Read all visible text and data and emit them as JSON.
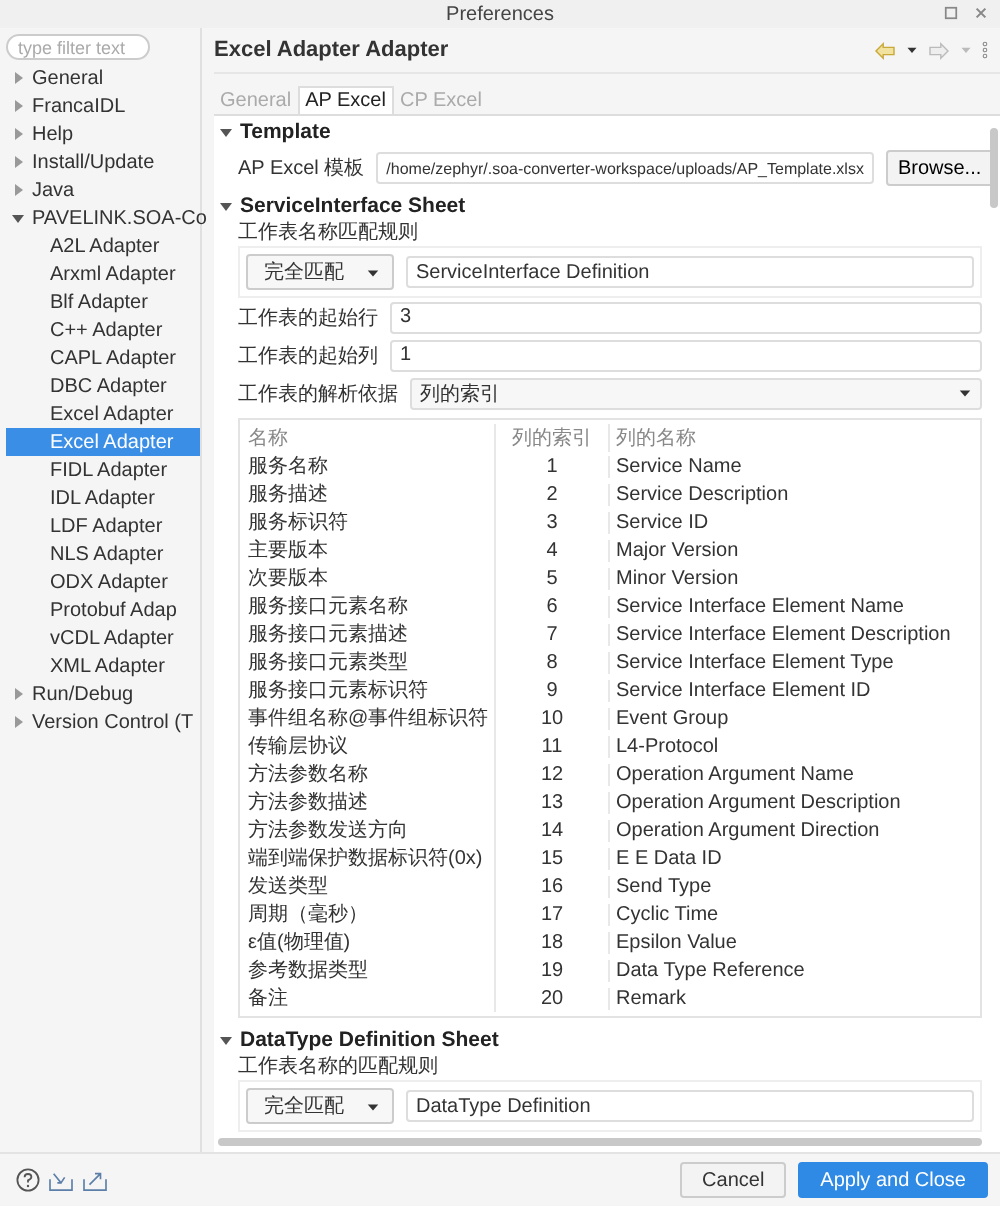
{
  "window": {
    "title": "Preferences"
  },
  "sidebar": {
    "filter_placeholder": "type filter text",
    "items": [
      {
        "label": "General",
        "expanded": false,
        "selected": false
      },
      {
        "label": "FrancaIDL",
        "expanded": false,
        "selected": false
      },
      {
        "label": "Help",
        "expanded": false,
        "selected": false
      },
      {
        "label": "Install/Update",
        "expanded": false,
        "selected": false
      },
      {
        "label": "Java",
        "expanded": false,
        "selected": false
      },
      {
        "label": "PAVELINK.SOA-Co",
        "expanded": true,
        "selected": false,
        "children": [
          {
            "label": "A2L Adapter",
            "selected": false
          },
          {
            "label": "Arxml Adapter",
            "selected": false
          },
          {
            "label": "Blf Adapter",
            "selected": false
          },
          {
            "label": "C++ Adapter",
            "selected": false
          },
          {
            "label": "CAPL Adapter",
            "selected": false
          },
          {
            "label": "DBC Adapter",
            "selected": false
          },
          {
            "label": "Excel Adapter",
            "selected": false
          },
          {
            "label": "Excel Adapter",
            "selected": true
          },
          {
            "label": "FIDL Adapter",
            "selected": false
          },
          {
            "label": "IDL Adapter",
            "selected": false
          },
          {
            "label": "LDF Adapter",
            "selected": false
          },
          {
            "label": "NLS Adapter",
            "selected": false
          },
          {
            "label": "ODX Adapter",
            "selected": false
          },
          {
            "label": "Protobuf Adap",
            "selected": false
          },
          {
            "label": "vCDL Adapter",
            "selected": false
          },
          {
            "label": "XML Adapter",
            "selected": false
          }
        ]
      },
      {
        "label": "Run/Debug",
        "expanded": false,
        "selected": false
      },
      {
        "label": "Version Control (T",
        "expanded": false,
        "selected": false
      }
    ]
  },
  "page": {
    "title": "Excel Adapter Adapter",
    "tabs": [
      {
        "label": "General",
        "selected": false
      },
      {
        "label": "AP Excel",
        "selected": true
      },
      {
        "label": "CP Excel",
        "selected": false
      }
    ]
  },
  "template": {
    "heading": "Template",
    "expanded": true,
    "label": "AP Excel 模板",
    "path": "/home/zephyr/.soa-converter-workspace/uploads/AP_Template.xlsx",
    "button": "Browse..."
  },
  "service_sheet": {
    "heading": "ServiceInterface Sheet",
    "expanded": true,
    "match_label": "工作表名称匹配规则",
    "match_mode": "完全匹配",
    "match_value": "ServiceInterface Definition",
    "settings": [
      {
        "label": "工作表的起始行",
        "kind": "text",
        "value": "3"
      },
      {
        "label": "工作表的起始列",
        "kind": "text",
        "value": "1"
      },
      {
        "label": "工作表的解析依据",
        "kind": "select",
        "value": "列的索引"
      }
    ],
    "table": {
      "columns": [
        "名称",
        "列的索引",
        "列的名称"
      ],
      "rows": [
        [
          "服务名称",
          "1",
          "Service Name"
        ],
        [
          "服务描述",
          "2",
          "Service Description"
        ],
        [
          "服务标识符",
          "3",
          "Service ID"
        ],
        [
          "主要版本",
          "4",
          "Major Version"
        ],
        [
          "次要版本",
          "5",
          "Minor Version"
        ],
        [
          "服务接口元素名称",
          "6",
          "Service Interface Element Name"
        ],
        [
          "服务接口元素描述",
          "7",
          "Service Interface Element Description"
        ],
        [
          "服务接口元素类型",
          "8",
          "Service Interface Element Type"
        ],
        [
          "服务接口元素标识符",
          "9",
          "Service Interface Element ID"
        ],
        [
          "事件组名称@事件组标识符",
          "10",
          "Event Group"
        ],
        [
          "传输层协议",
          "11",
          "L4-Protocol"
        ],
        [
          "方法参数名称",
          "12",
          "Operation Argument Name"
        ],
        [
          "方法参数描述",
          "13",
          "Operation Argument Description"
        ],
        [
          "方法参数发送方向",
          "14",
          "Operation Argument Direction"
        ],
        [
          "端到端保护数据标识符(0x)",
          "15",
          "E E Data ID"
        ],
        [
          "发送类型",
          "16",
          "Send Type"
        ],
        [
          "周期（毫秒）",
          "17",
          "Cyclic Time"
        ],
        [
          "ε值(物理值)",
          "18",
          "Epsilon Value"
        ],
        [
          "参考数据类型",
          "19",
          "Data Type Reference"
        ],
        [
          "备注",
          "20",
          "Remark"
        ]
      ]
    }
  },
  "datatype_sheet": {
    "heading": "DataType Definition Sheet",
    "expanded": true,
    "match_label": "工作表名称的匹配规则",
    "match_mode": "完全匹配",
    "match_value": "DataType Definition"
  },
  "footer": {
    "buttons": [
      {
        "label": "Cancel",
        "kind": "secondary"
      },
      {
        "label": "Apply and Close",
        "kind": "primary"
      }
    ]
  }
}
